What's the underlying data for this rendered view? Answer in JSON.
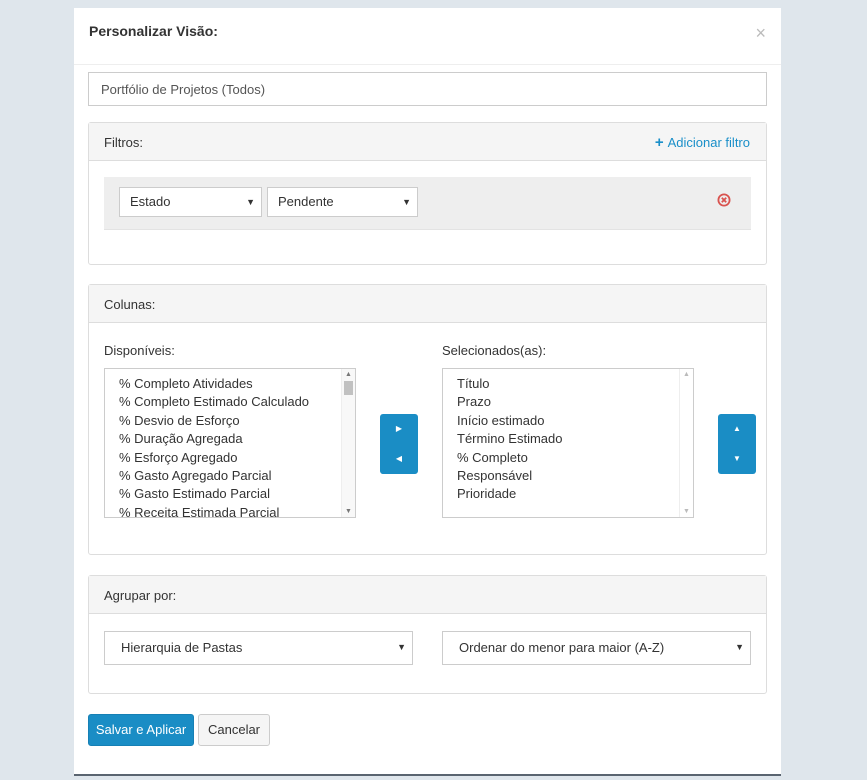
{
  "dialog": {
    "title": "Personalizar Visão:",
    "close_icon": "×"
  },
  "view_name": {
    "value": "Portfólio de Projetos (Todos)"
  },
  "filters": {
    "title": "Filtros:",
    "add_label": "Adicionar filtro",
    "add_icon": "+",
    "row": {
      "field": "Estado",
      "value": "Pendente"
    }
  },
  "columns": {
    "title": "Colunas:",
    "available_label": "Disponíveis:",
    "selected_label": "Selecionados(as):",
    "available": [
      "% Completo Atividades",
      "% Completo Estimado Calculado",
      "% Desvio de Esforço",
      "% Duração Agregada",
      "% Esforço Agregado",
      "% Gasto Agregado Parcial",
      "% Gasto Estimado Parcial",
      "% Receita Estimada Parcial"
    ],
    "selected": [
      "Título",
      "Prazo",
      "Início estimado",
      "Término Estimado",
      "% Completo",
      "Responsável",
      "Prioridade"
    ]
  },
  "group_by": {
    "title": "Agrupar por:",
    "group_value": "Hierarquia de Pastas",
    "order_value": "Ordenar do menor para maior (A-Z)"
  },
  "footer": {
    "save_label": "Salvar e Aplicar",
    "cancel_label": "Cancelar"
  },
  "icons": {
    "caret": "▼",
    "right": "▶",
    "left": "◀",
    "up": "▲",
    "down": "▼"
  },
  "colors": {
    "accent": "#1a8dc5",
    "danger": "#d9534f"
  }
}
